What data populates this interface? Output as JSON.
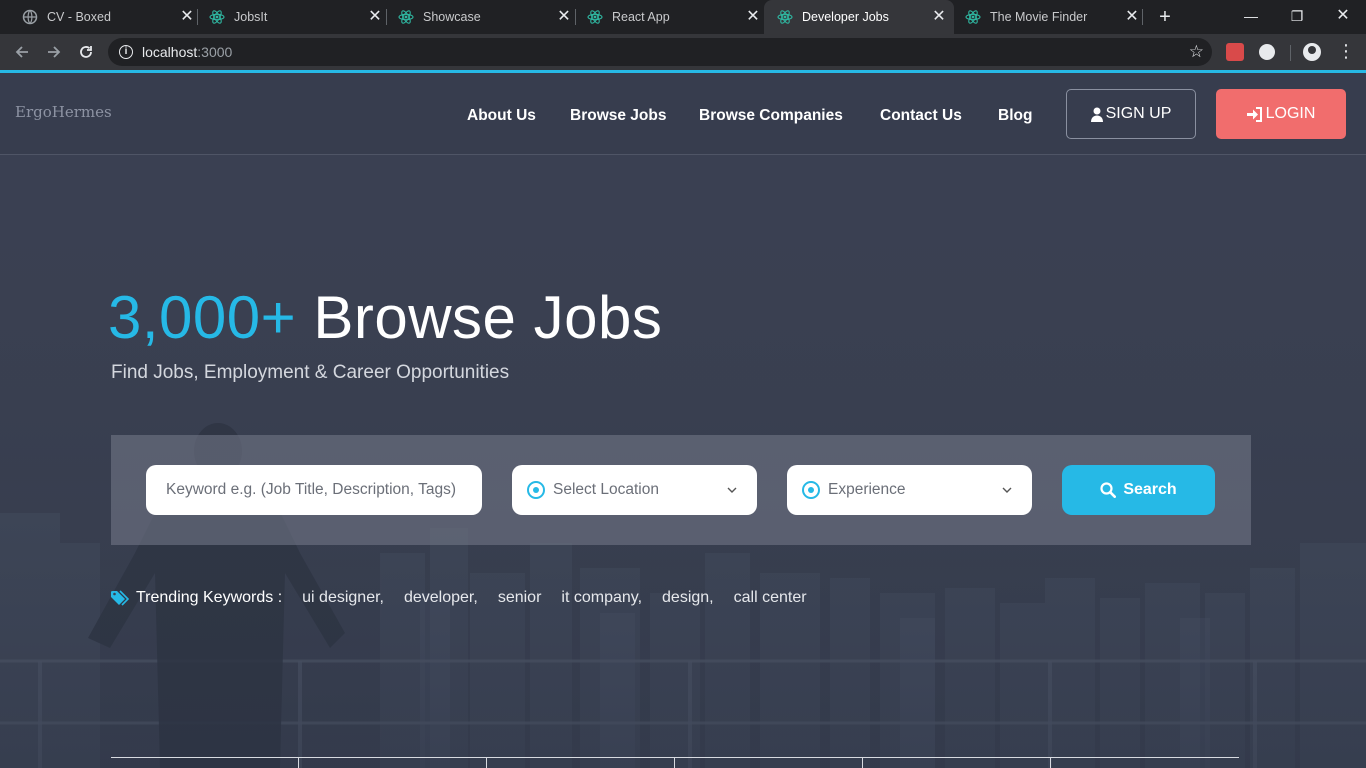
{
  "browser": {
    "tabs": [
      {
        "title": "CV - Boxed",
        "icon": "globe-icon",
        "active": false
      },
      {
        "title": "JobsIt",
        "icon": "react-icon",
        "active": false
      },
      {
        "title": "Showcase",
        "icon": "react-icon",
        "active": false
      },
      {
        "title": "React App",
        "icon": "react-icon",
        "active": false
      },
      {
        "title": "Developer Jobs",
        "icon": "react-icon",
        "active": true
      },
      {
        "title": "The Movie Finder",
        "icon": "react-icon",
        "active": false
      }
    ],
    "close_glyph": "✕",
    "new_tab_glyph": "+",
    "window_controls": {
      "minimize": "—",
      "restore": "❐",
      "close": "✕"
    },
    "url_host": "localhost",
    "url_port": ":3000",
    "colors": {
      "chrome_dark": "#202124",
      "chrome_toolbar": "#35363a",
      "accent": "#26b9e6"
    }
  },
  "site": {
    "brand": "ErgoHermes",
    "nav": [
      "About Us",
      "Browse Jobs",
      "Browse Companies",
      "Contact Us",
      "Blog"
    ],
    "signup_label": "SIGN UP",
    "login_label": "LOGIN",
    "colors": {
      "accent": "#26b9e6",
      "login": "#f16d6d",
      "background": "#3b4252"
    }
  },
  "hero": {
    "count": "3,000+",
    "title_rest": " Browse Jobs",
    "subtitle": "Find Jobs, Employment & Career Opportunities"
  },
  "search": {
    "keyword_placeholder": "Keyword e.g. (Job Title, Description, Tags)",
    "keyword_value": "",
    "location_selected": "Select Location",
    "experience_selected": "Experience",
    "button_label": "Search"
  },
  "trending": {
    "label": "Trending Keywords :",
    "keywords": [
      "ui designer,",
      "developer,",
      "senior",
      "it company,",
      "design,",
      "call center"
    ]
  }
}
